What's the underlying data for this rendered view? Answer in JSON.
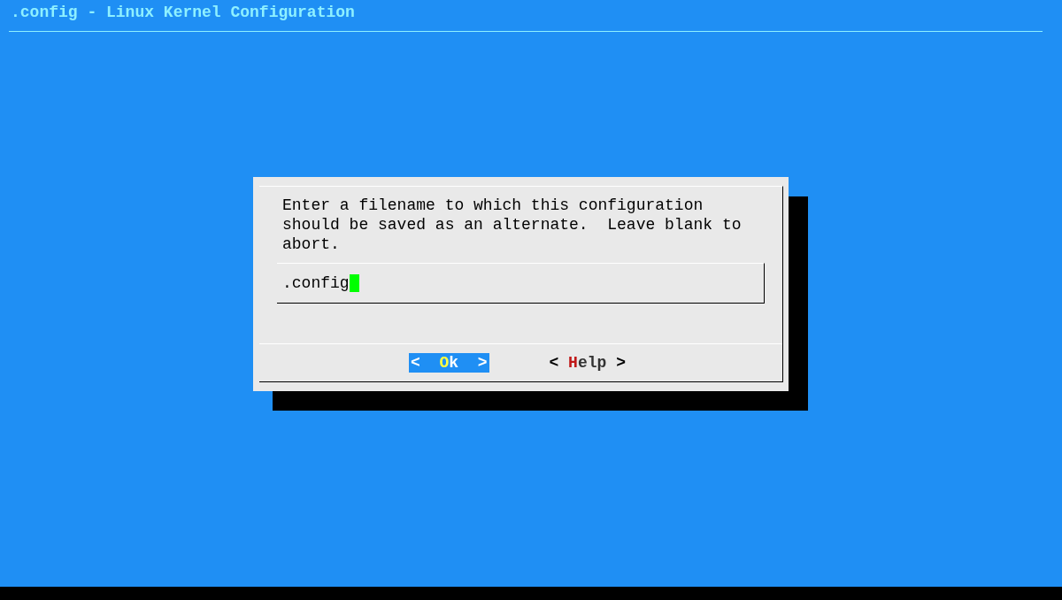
{
  "window": {
    "title": ".config - Linux Kernel Configuration"
  },
  "dialog": {
    "message": "Enter a filename to which this configuration should be saved as an alternate.  Leave blank to abort.",
    "input": {
      "value": ".config"
    },
    "buttons": [
      {
        "prefix": "<  ",
        "hotkey": "O",
        "rest": "k",
        "suffix": "  >",
        "selected": true
      },
      {
        "prefix": "< ",
        "hotkey": "H",
        "rest": "elp",
        "suffix": " >",
        "selected": false
      }
    ]
  }
}
